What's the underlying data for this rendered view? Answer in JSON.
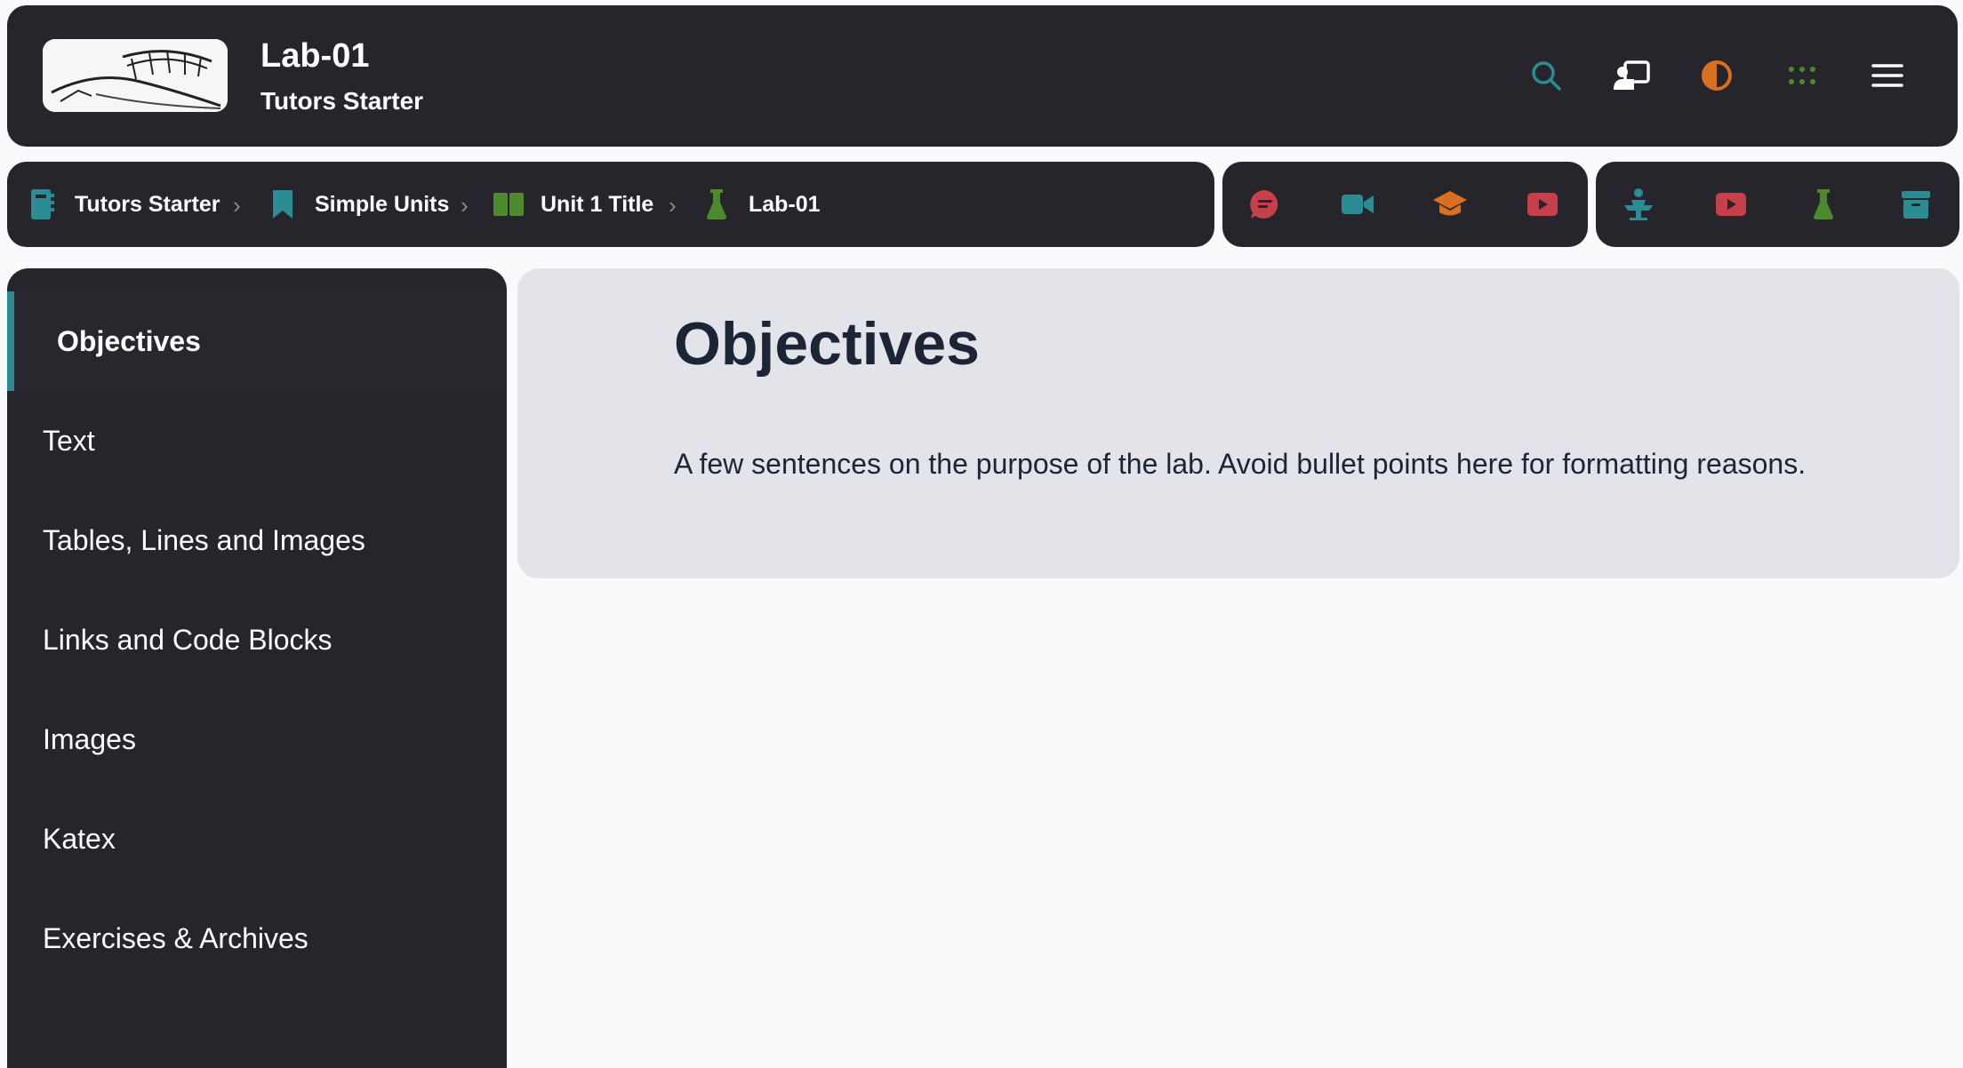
{
  "header": {
    "title": "Lab-01",
    "subtitle": "Tutors Starter",
    "icons": [
      "search-icon",
      "presenter-icon",
      "theme-contrast-icon",
      "apps-grid-icon",
      "menu-icon"
    ]
  },
  "breadcrumb": {
    "items": [
      {
        "label": "Tutors Starter",
        "icon": "course-notebook-icon"
      },
      {
        "label": "Simple Units",
        "icon": "bookmark-icon"
      },
      {
        "label": "Unit 1 Title",
        "icon": "unit-book-icon"
      },
      {
        "label": "Lab-01",
        "icon": "lab-flask-icon"
      }
    ]
  },
  "toolbar_media": [
    "chat-icon",
    "video-icon",
    "graduation-cap-icon",
    "youtube-icon"
  ],
  "toolbar_types": [
    "lecture-podium-icon",
    "youtube-icon",
    "lab-flask-icon",
    "archive-icon"
  ],
  "sidebar": {
    "items": [
      {
        "label": "Objectives",
        "active": true
      },
      {
        "label": "Text"
      },
      {
        "label": "Tables, Lines and Images"
      },
      {
        "label": "Links and Code Blocks"
      },
      {
        "label": "Images"
      },
      {
        "label": "Katex"
      },
      {
        "label": "Exercises & Archives"
      }
    ]
  },
  "content": {
    "heading": "Objectives",
    "paragraph": "A few sentences on the purpose of the lab. Avoid bullet points here for formatting reasons."
  },
  "colors": {
    "panel": "#27252c",
    "teal": "#2b8c93",
    "orange": "#d96f20",
    "red": "#c5404a",
    "green": "#4d8a2e",
    "card": "#e3e4e9",
    "text_dark": "#1b2535"
  }
}
